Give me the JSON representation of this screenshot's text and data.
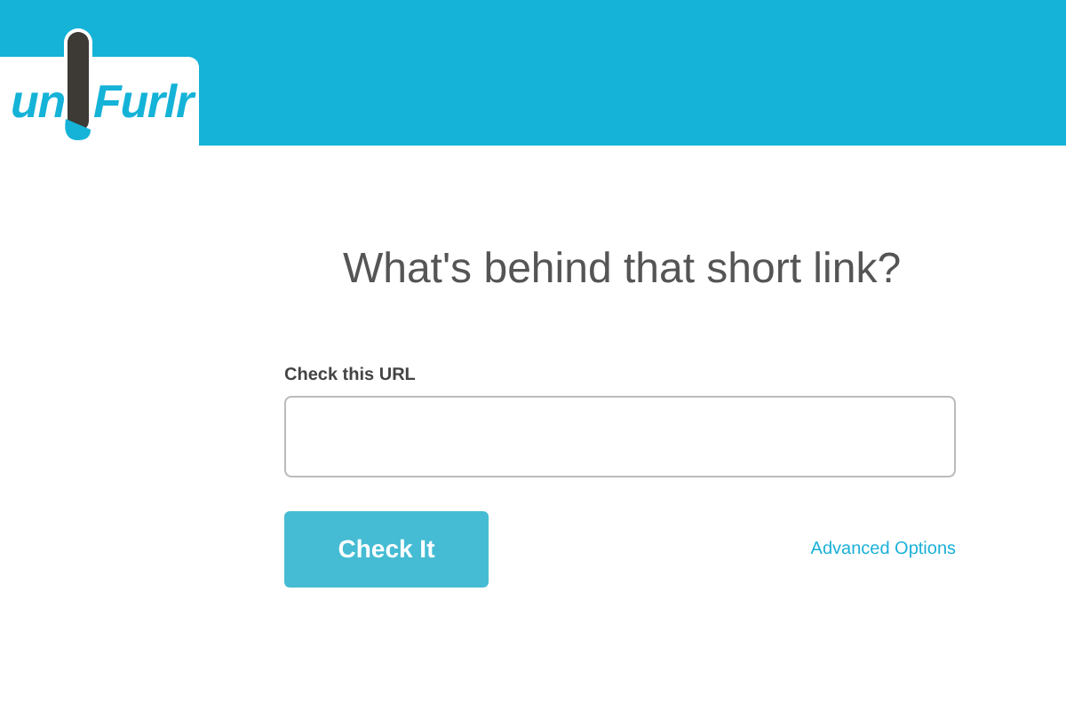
{
  "header": {
    "logo": {
      "left": "un",
      "right": "Furlr"
    }
  },
  "title": "What's behind that short link?",
  "form": {
    "label": "Check this URL",
    "button": "Check It",
    "link": "Advanced Options"
  }
}
